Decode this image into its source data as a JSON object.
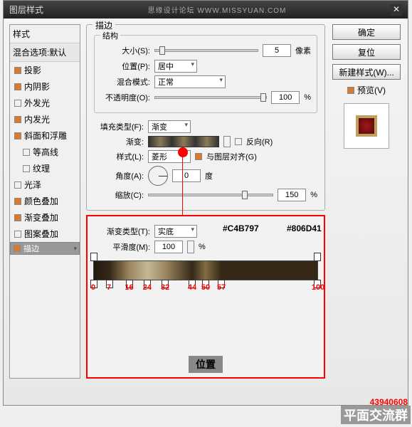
{
  "titlebar": {
    "title": "图层样式",
    "brand": "思缘设计论坛  WWW.MISSYUAN.COM"
  },
  "sidebar": {
    "header": "样式",
    "sub": "混合选项:默认",
    "items": [
      {
        "label": "投影",
        "checked": true
      },
      {
        "label": "内阴影",
        "checked": true
      },
      {
        "label": "外发光",
        "checked": false
      },
      {
        "label": "内发光",
        "checked": true
      },
      {
        "label": "斜面和浮雕",
        "checked": true
      },
      {
        "label": "等高线",
        "checked": false,
        "indent": true
      },
      {
        "label": "纹理",
        "checked": false,
        "indent": true
      },
      {
        "label": "光泽",
        "checked": false
      },
      {
        "label": "颜色叠加",
        "checked": true
      },
      {
        "label": "渐变叠加",
        "checked": true
      },
      {
        "label": "图案叠加",
        "checked": false
      },
      {
        "label": "描边",
        "checked": true,
        "selected": true
      }
    ]
  },
  "stroke": {
    "group_title": "描边",
    "struct_title": "结构",
    "size_label": "大小(S):",
    "size_value": "5",
    "size_unit": "像素",
    "position_label": "位置(P):",
    "position_value": "居中",
    "blend_label": "混合模式:",
    "blend_value": "正常",
    "opacity_label": "不透明度(O):",
    "opacity_value": "100",
    "opacity_unit": "%",
    "filltype_label": "填充类型(F):",
    "filltype_value": "渐变",
    "gradient_label": "渐变:",
    "reverse_label": "反向(R)",
    "style_label": "样式(L):",
    "style_value": "菱形",
    "align_label": "与图层对齐(G)",
    "angle_label": "角度(A):",
    "angle_value": "0",
    "angle_unit": "度",
    "scale_label": "缩放(C):",
    "scale_value": "150",
    "scale_unit": "%"
  },
  "right": {
    "ok": "确定",
    "cancel": "复位",
    "newstyle": "新建样式(W)...",
    "preview": "预览(V)"
  },
  "grad_editor": {
    "type_label": "渐变类型(T):",
    "type_value": "实底",
    "smooth_label": "平滑度(M):",
    "smooth_value": "100",
    "smooth_unit": "%",
    "hex1": "#C4B797",
    "hex2": "#806D41",
    "stops": [
      "0",
      "7",
      "16",
      "24",
      "32",
      "44",
      "50",
      "57",
      "100"
    ],
    "pos_label": "位置"
  },
  "watermark": {
    "id": "43940608",
    "group": "平面交流群"
  }
}
